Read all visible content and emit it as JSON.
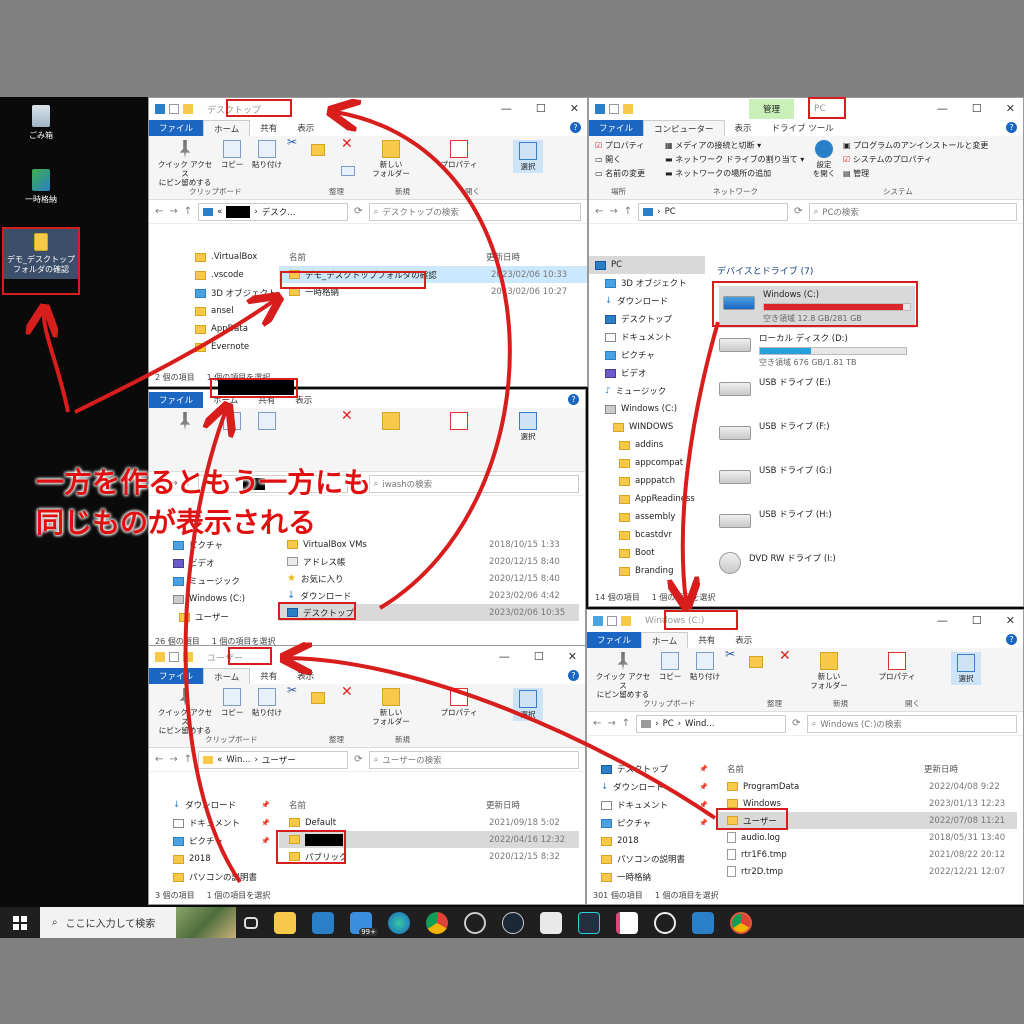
{
  "desktop": {
    "icons": [
      {
        "label": "ごみ箱"
      },
      {
        "label": "一時格納"
      },
      {
        "label": "デモ_デスクトップフォルダの確認"
      }
    ]
  },
  "common": {
    "tab_file": "ファイル",
    "tab_home": "ホーム",
    "tab_share": "共有",
    "tab_view": "表示",
    "btn_pin": "クイック アクセス\nにピン留めする",
    "btn_copy": "コピー",
    "btn_paste": "貼り付け",
    "grp_clipboard": "クリップボード",
    "grp_organize": "整理",
    "grp_new": "新規",
    "grp_open": "開く",
    "btn_newfolder": "新しい\nフォルダー",
    "btn_properties": "プロパティ",
    "btn_select": "選択",
    "col_name": "名前",
    "col_date": "更新日時",
    "help": "?"
  },
  "win_desktop": {
    "title": "デスクトップ",
    "path_prefix": "«",
    "path": "デスク...",
    "search": "デスクトップの検索",
    "nav": [
      ".VirtualBox",
      ".vscode",
      "3D オブジェクト",
      "ansel",
      "AppData",
      "Evernote"
    ],
    "files": [
      {
        "name": "デモ_デスクトップフォルダの確認",
        "date": "2023/02/06 10:33"
      },
      {
        "name": "一時格納",
        "date": "2023/02/06 10:27"
      }
    ],
    "status_count": "2 個の項目",
    "status_sel": "1 個の項目を選択"
  },
  "win_user": {
    "search": "iwashの検索",
    "nav": [
      "ピクチャ",
      "ビデオ",
      "ミュージック",
      "Windows (C:)",
      "ユーザー"
    ],
    "files": [
      {
        "name": "VirtualBox VMs",
        "date": "2018/10/15 1:33"
      },
      {
        "name": "アドレス帳",
        "date": "2020/12/15 8:40"
      },
      {
        "name": "お気に入り",
        "date": "2020/12/15 8:40"
      },
      {
        "name": "ダウンロード",
        "date": "2023/02/06 4:42"
      },
      {
        "name": "デスクトップ",
        "date": "2023/02/06 10:35"
      }
    ],
    "status_count": "26 個の項目",
    "status_sel": "1 個の項目を選択"
  },
  "win_users": {
    "title": "ユーザー",
    "path_prefix": "«",
    "path1": "Win...",
    "path2": "ユーザー",
    "search": "ユーザーの検索",
    "nav": [
      "ダウンロード",
      "ドキュメント",
      "ピクチャ",
      "2018",
      "パソコンの説明書"
    ],
    "files": [
      {
        "name": "Default",
        "date": "2021/09/18 5:02"
      },
      {
        "name": "",
        "date": "2022/04/16 12:32"
      },
      {
        "name": "パブリック",
        "date": "2020/12/15 8:32"
      }
    ],
    "status_count": "3 個の項目",
    "status_sel": "1 個の項目を選択"
  },
  "win_pc": {
    "title": "PC",
    "context_tab": "管理",
    "tab_computer": "コンピューター",
    "tab_drive_tools": "ドライブ ツール",
    "btn_properties": "プロパティ",
    "btn_open": "開く",
    "btn_rename": "名前の変更",
    "btn_media": "メディアの接続と切断",
    "btn_map_drive": "ネットワーク ドライブの割り当て",
    "btn_add_loc": "ネットワークの場所の追加",
    "btn_settings": "設定\nを開く",
    "btn_uninstall": "プログラムのアンインストールと変更",
    "btn_sysprops": "システムのプロパティ",
    "btn_manage": "管理",
    "grp_location": "場所",
    "grp_network": "ネットワーク",
    "grp_system": "システム",
    "path": "PC",
    "search": "PCの検索",
    "nav": [
      "PC",
      "3D オブジェクト",
      "ダウンロード",
      "デスクトップ",
      "ドキュメント",
      "ピクチャ",
      "ビデオ",
      "ミュージック",
      "Windows (C:)",
      "WINDOWS",
      "addins",
      "appcompat",
      "apppatch",
      "AppReadiness",
      "assembly",
      "bcastdvr",
      "Boot",
      "Branding"
    ],
    "section": "デバイスとドライブ (7)",
    "drives": [
      {
        "name": "Windows (C:)",
        "space": "空き領域 12.8 GB/281 GB",
        "used_fraction": 0.95,
        "color": "#d9262a"
      },
      {
        "name": "ローカル ディスク (D:)",
        "space": "空き領域 676 GB/1.81 TB",
        "used_fraction": 0.35,
        "color": "#26a0da"
      },
      {
        "name": "USB ドライブ (E:)"
      },
      {
        "name": "USB ドライブ (F:)"
      },
      {
        "name": "USB ドライブ (G:)"
      },
      {
        "name": "USB ドライブ (H:)"
      },
      {
        "name": "DVD RW ドライブ (I:)"
      }
    ],
    "status_count": "14 個の項目",
    "status_sel": "1 個の項目を選択"
  },
  "win_c": {
    "title": "Windows (C:)",
    "path1": "PC",
    "path2": "Wind...",
    "search": "Windows (C:)の検索",
    "nav": [
      "デスクトップ",
      "ダウンロード",
      "ドキュメント",
      "ピクチャ",
      "2018",
      "パソコンの説明書",
      "一時格納"
    ],
    "files": [
      {
        "name": "ProgramData",
        "date": "2022/04/08 9:22",
        "type": "folder"
      },
      {
        "name": "Windows",
        "date": "2023/01/13 12:23",
        "type": "folder"
      },
      {
        "name": "ユーザー",
        "date": "2022/07/08 11:21",
        "type": "folder"
      },
      {
        "name": "audio.log",
        "date": "2018/05/31 13:40",
        "type": "file"
      },
      {
        "name": "rtr1F6.tmp",
        "date": "2021/08/22 20:12",
        "type": "file"
      },
      {
        "name": "rtr2D.tmp",
        "date": "2022/12/21 12:07",
        "type": "file"
      }
    ],
    "status_count": "301 個の項目",
    "status_sel": "1 個の項目を選択"
  },
  "taskbar": {
    "search_placeholder": "ここに入力して検索",
    "mail_badge": "99+"
  },
  "annotation": {
    "line1": "一方を作るともう一方にも",
    "line2": "同じものが表示される"
  },
  "colors": {
    "accent_blue": "#1a66c2",
    "annotation_red": "#d81d1d"
  }
}
